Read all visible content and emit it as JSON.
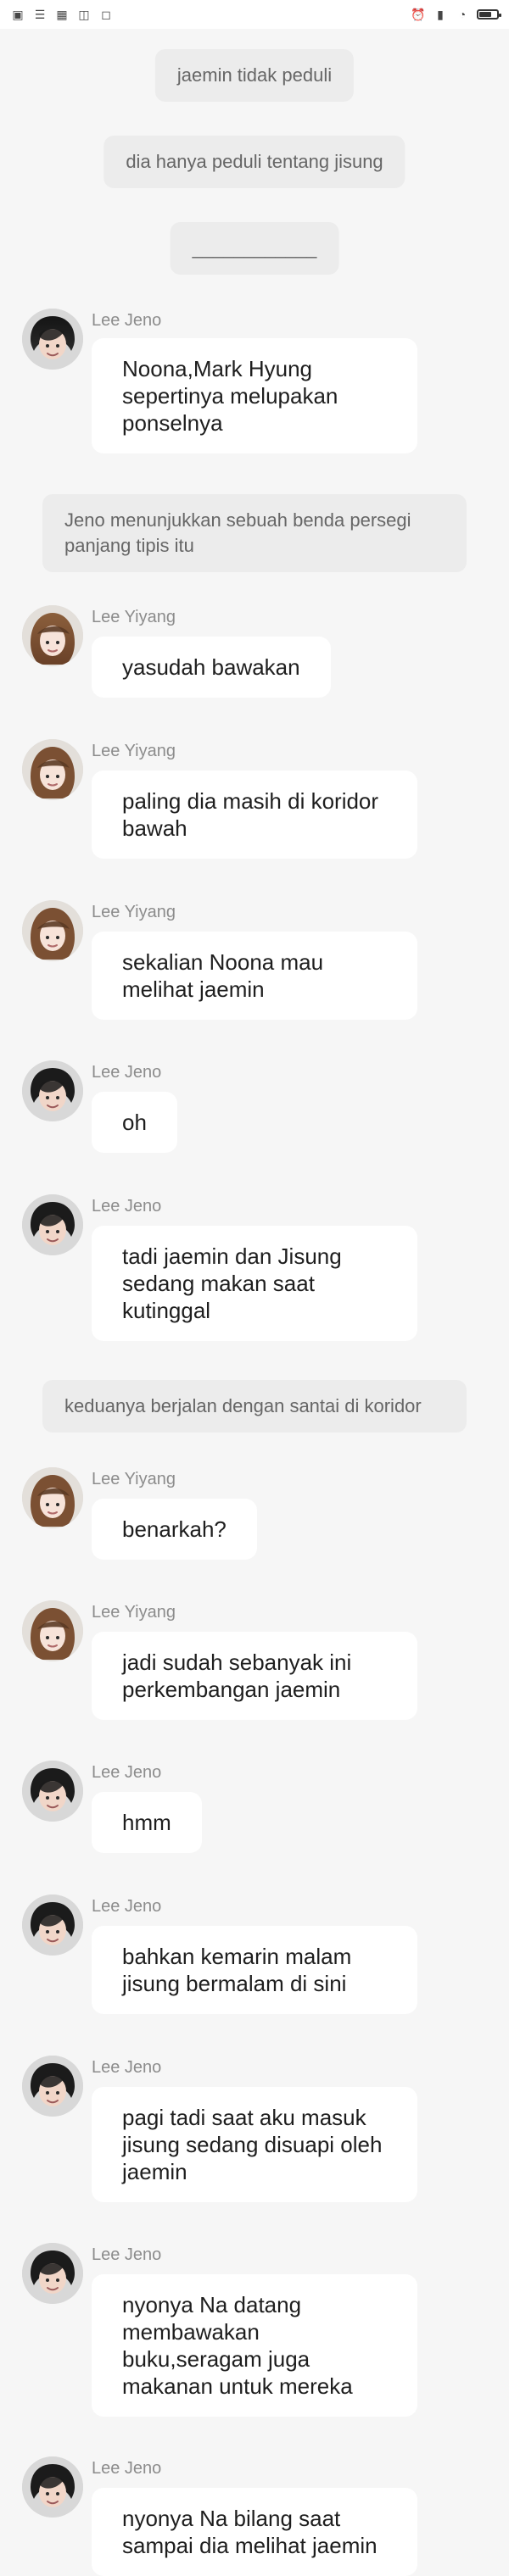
{
  "status_bar": {
    "left_icons": [
      "app-icon-1",
      "app-icon-2",
      "app-icon-3",
      "app-icon-4",
      "app-icon-5"
    ],
    "right_icons": [
      "alarm-icon",
      "signal-icon",
      "wifi-icon",
      "battery-icon"
    ]
  },
  "system_messages": [
    {
      "text": "jaemin tidak peduli"
    },
    {
      "text": "dia hanya peduli tentang jisung"
    },
    {
      "text": "____________"
    },
    {
      "text": "Jeno menunjukkan sebuah benda persegi panjang tipis itu"
    },
    {
      "text": "keduanya berjalan dengan santai di koridor"
    }
  ],
  "messages": [
    {
      "sender": "Lee Jeno",
      "text": "Noona,Mark Hyung sepertinya melupakan ponselnya"
    },
    {
      "sender": "Lee Yiyang",
      "text": "yasudah bawakan"
    },
    {
      "sender": "Lee Yiyang",
      "text": "paling dia masih di koridor bawah"
    },
    {
      "sender": "Lee Yiyang",
      "text": "sekalian Noona mau melihat jaemin"
    },
    {
      "sender": "Lee Jeno",
      "text": "oh"
    },
    {
      "sender": "Lee Jeno",
      "text": "tadi jaemin dan Jisung sedang makan saat kutinggal"
    },
    {
      "sender": "Lee Yiyang",
      "text": "benarkah?"
    },
    {
      "sender": "Lee Yiyang",
      "text": "jadi sudah sebanyak ini perkembangan jaemin"
    },
    {
      "sender": "Lee Jeno",
      "text": "hmm"
    },
    {
      "sender": "Lee Jeno",
      "text": "bahkan kemarin malam jisung bermalam di sini"
    },
    {
      "sender": "Lee Jeno",
      "text": "pagi tadi saat aku masuk jisung sedang disuapi oleh jaemin"
    },
    {
      "sender": "Lee Jeno",
      "text": "nyonya Na datang membawakan buku,seragam juga makanan untuk mereka"
    },
    {
      "sender": "Lee Jeno",
      "text": "nyonya Na bilang saat sampai dia melihat jaemin"
    }
  ],
  "colors": {
    "background": "#f6f6f6",
    "bubble": "#ffffff",
    "system_bubble": "#ececec",
    "sender_name": "#8c8c8c",
    "text": "#1e1e1e"
  }
}
